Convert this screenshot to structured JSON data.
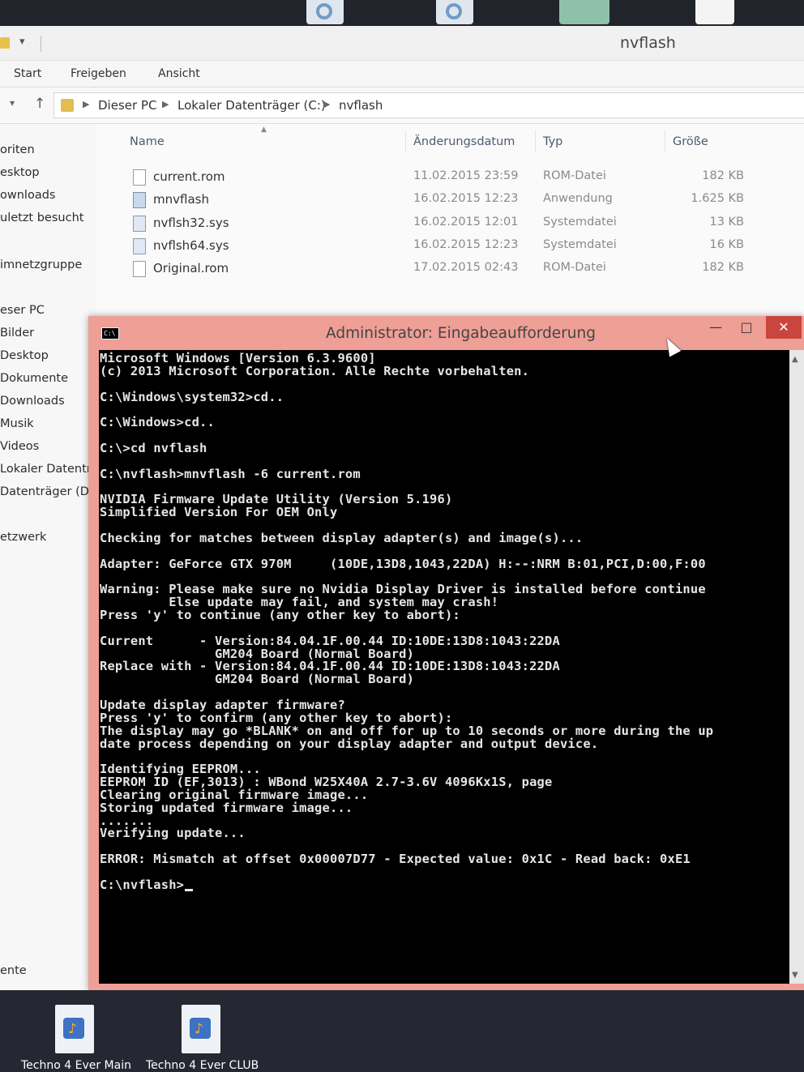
{
  "explorer": {
    "title": "nvflash",
    "ribbon_tabs": [
      "Start",
      "Freigeben",
      "Ansicht"
    ],
    "breadcrumb": [
      "Dieser PC",
      "Lokaler Datenträger (C:)",
      "nvflash"
    ],
    "nav_items": [
      "oriten",
      "esktop",
      "ownloads",
      "uletzt besucht",
      "imnetzgruppe",
      "eser PC",
      "Bilder",
      "Desktop",
      "Dokumente",
      "Downloads",
      "Musik",
      "Videos",
      "Lokaler Datenträ",
      "Datenträger (D:)",
      "etzwerk",
      "ente"
    ],
    "columns": {
      "name": "Name",
      "date": "Änderungsdatum",
      "type": "Typ",
      "size": "Größe"
    },
    "files": [
      {
        "name": "current.rom",
        "date": "11.02.2015 23:59",
        "type": "ROM-Datei",
        "size": "182 KB",
        "icon": "file-icon"
      },
      {
        "name": "mnvflash",
        "date": "16.02.2015 12:23",
        "type": "Anwendung",
        "size": "1.625 KB",
        "icon": "application-icon"
      },
      {
        "name": "nvflsh32.sys",
        "date": "16.02.2015 12:01",
        "type": "Systemdatei",
        "size": "13 KB",
        "icon": "system-file-icon"
      },
      {
        "name": "nvflsh64.sys",
        "date": "16.02.2015 12:23",
        "type": "Systemdatei",
        "size": "16 KB",
        "icon": "system-file-icon"
      },
      {
        "name": "Original.rom",
        "date": "17.02.2015 02:43",
        "type": "ROM-Datei",
        "size": "182 KB",
        "icon": "file-icon"
      }
    ]
  },
  "console": {
    "title": "Administrator: Eingabeaufforderung",
    "icon_label": "C:\\",
    "minimize": "—",
    "maximize": "□",
    "close": "✕",
    "scroll_up": "▲",
    "scroll_down": "▼",
    "lines": [
      "Microsoft Windows [Version 6.3.9600]",
      "(c) 2013 Microsoft Corporation. Alle Rechte vorbehalten.",
      "",
      "C:\\Windows\\system32>cd..",
      "",
      "C:\\Windows>cd..",
      "",
      "C:\\>cd nvflash",
      "",
      "C:\\nvflash>mnvflash -6 current.rom",
      "",
      "NVIDIA Firmware Update Utility (Version 5.196)",
      "Simplified Version For OEM Only",
      "",
      "Checking for matches between display adapter(s) and image(s)...",
      "",
      "Adapter: GeForce GTX 970M     (10DE,13D8,1043,22DA) H:--:NRM B:01,PCI,D:00,F:00",
      "",
      "Warning: Please make sure no Nvidia Display Driver is installed before continue",
      "         Else update may fail, and system may crash!",
      "Press 'y' to continue (any other key to abort):",
      "",
      "Current      - Version:84.04.1F.00.44 ID:10DE:13D8:1043:22DA",
      "               GM204 Board (Normal Board)",
      "Replace with - Version:84.04.1F.00.44 ID:10DE:13D8:1043:22DA",
      "               GM204 Board (Normal Board)",
      "",
      "Update display adapter firmware?",
      "Press 'y' to confirm (any other key to abort):",
      "The display may go *BLANK* on and off for up to 10 seconds or more during the up",
      "date process depending on your display adapter and output device.",
      "",
      "Identifying EEPROM...",
      "EEPROM ID (EF,3013) : WBond W25X40A 2.7-3.6V 4096Kx1S, page",
      "Clearing original firmware image...",
      "Storing updated firmware image...",
      ".......",
      "Verifying update...",
      "",
      "ERROR: Mismatch at offset 0x00007D77 - Expected value: 0x1C - Read back: 0xE1",
      "",
      "C:\\nvflash>"
    ]
  },
  "taskbar": {
    "items": [
      "Techno 4 Ever Main",
      "Techno 4 Ever CLUB"
    ]
  }
}
